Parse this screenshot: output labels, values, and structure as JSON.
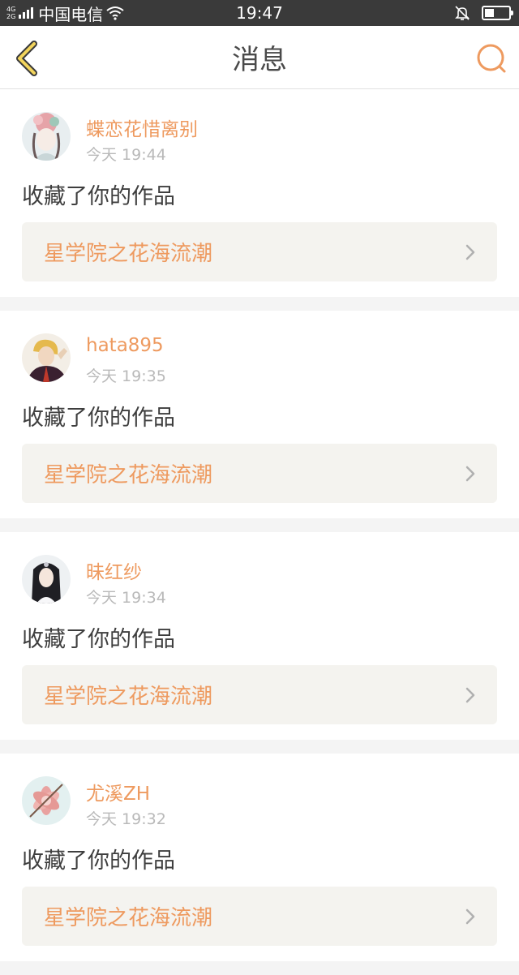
{
  "status_bar": {
    "network_top": "4G",
    "network_bottom": "2G",
    "carrier": "中国电信",
    "time": "19:47",
    "battery_level": 0.4
  },
  "header": {
    "title": "消息",
    "back_icon": "chevron-left-icon",
    "search_icon": "search-icon",
    "accent_color": "#ee9a5f"
  },
  "messages": [
    {
      "username": "蝶恋花惜离别",
      "time": "今天 19:44",
      "action": "收藏了你的作品",
      "work_title": "星学院之花海流潮"
    },
    {
      "username": "hata895",
      "time": "今天 19:35",
      "action": "收藏了你的作品",
      "work_title": "星学院之花海流潮"
    },
    {
      "username": "昧红纱",
      "time": "今天 19:34",
      "action": "收藏了你的作品",
      "work_title": "星学院之花海流潮"
    },
    {
      "username": "尤溪ZH",
      "time": "今天 19:32",
      "action": "收藏了你的作品",
      "work_title": "星学院之花海流潮"
    }
  ]
}
